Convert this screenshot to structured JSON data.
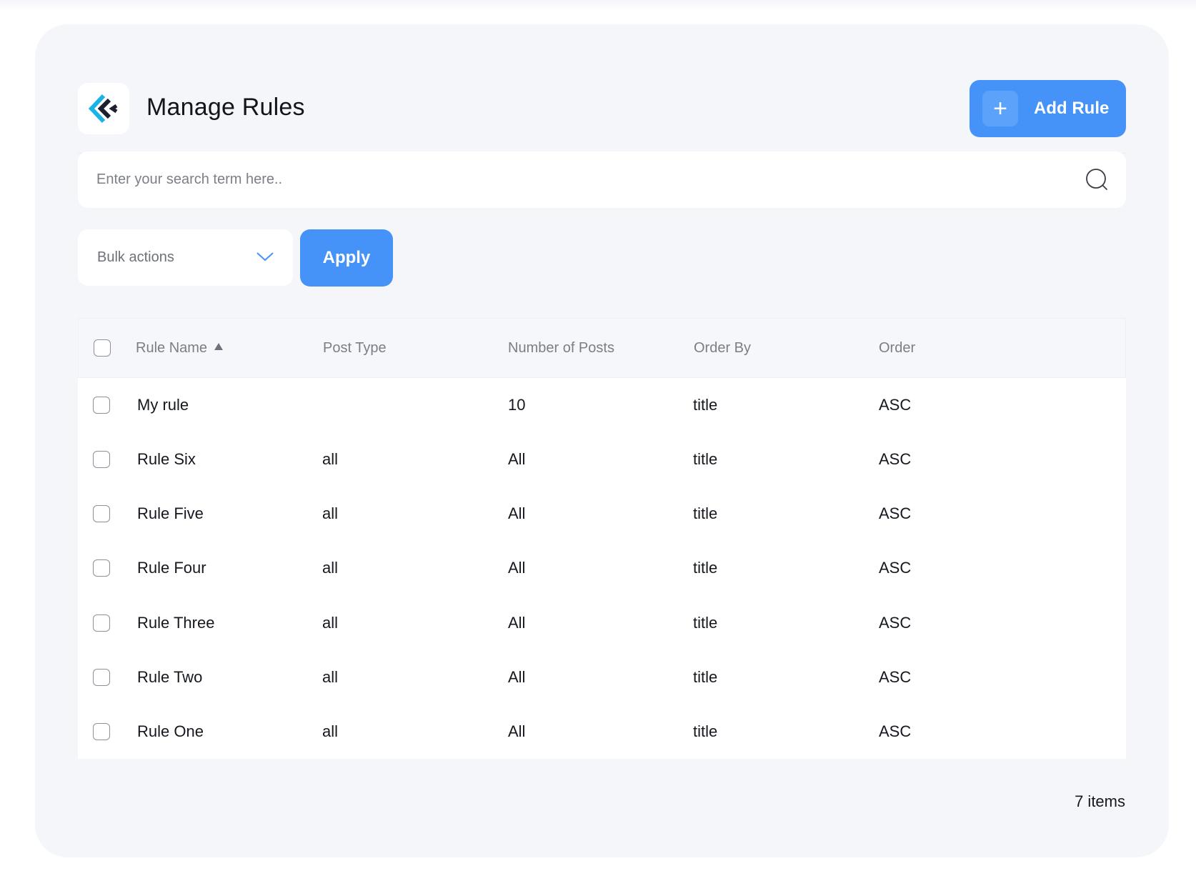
{
  "header": {
    "title": "Manage Rules",
    "logo_icon": "brand-chevron-logo-icon",
    "add_button_label": "Add Rule",
    "add_button_icon": "plus-icon"
  },
  "search": {
    "placeholder": "Enter your search term here..",
    "value": "",
    "icon": "search-icon"
  },
  "bulk": {
    "selected": "Bulk actions",
    "icon": "chevron-down-icon",
    "apply_label": "Apply"
  },
  "table": {
    "columns": [
      "Rule Name",
      "Post Type",
      "Number of Posts",
      "Order By",
      "Order"
    ],
    "sort_column": "Rule Name",
    "sort_direction": "asc",
    "rows": [
      {
        "name": "My rule",
        "post_type": "",
        "number": "10",
        "order_by": "title",
        "order": "ASC"
      },
      {
        "name": "Rule Six",
        "post_type": "all",
        "number": "All",
        "order_by": "title",
        "order": "ASC"
      },
      {
        "name": "Rule Five",
        "post_type": "all",
        "number": "All",
        "order_by": "title",
        "order": "ASC"
      },
      {
        "name": "Rule Four",
        "post_type": "all",
        "number": "All",
        "order_by": "title",
        "order": "ASC"
      },
      {
        "name": "Rule Three",
        "post_type": "all",
        "number": "All",
        "order_by": "title",
        "order": "ASC"
      },
      {
        "name": "Rule Two",
        "post_type": "all",
        "number": "All",
        "order_by": "title",
        "order": "ASC"
      },
      {
        "name": "Rule One",
        "post_type": "all",
        "number": "All",
        "order_by": "title",
        "order": "ASC"
      }
    ]
  },
  "footer": {
    "count_text": "7 items"
  },
  "colors": {
    "accent": "#4593f8",
    "panel_bg": "#f5f6f9",
    "logo_dark": "#1c2030",
    "logo_cyan": "#1ab3e6"
  }
}
